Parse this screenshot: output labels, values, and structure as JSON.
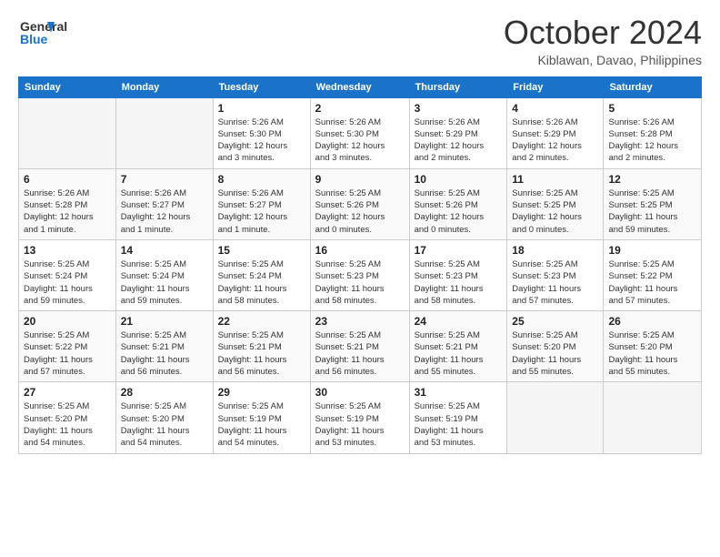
{
  "logo": {
    "line1": "General",
    "line2": "Blue"
  },
  "title": "October 2024",
  "subtitle": "Kiblawan, Davao, Philippines",
  "weekdays": [
    "Sunday",
    "Monday",
    "Tuesday",
    "Wednesday",
    "Thursday",
    "Friday",
    "Saturday"
  ],
  "weeks": [
    [
      {
        "day": "",
        "info": ""
      },
      {
        "day": "",
        "info": ""
      },
      {
        "day": "1",
        "info": "Sunrise: 5:26 AM\nSunset: 5:30 PM\nDaylight: 12 hours\nand 3 minutes."
      },
      {
        "day": "2",
        "info": "Sunrise: 5:26 AM\nSunset: 5:30 PM\nDaylight: 12 hours\nand 3 minutes."
      },
      {
        "day": "3",
        "info": "Sunrise: 5:26 AM\nSunset: 5:29 PM\nDaylight: 12 hours\nand 2 minutes."
      },
      {
        "day": "4",
        "info": "Sunrise: 5:26 AM\nSunset: 5:29 PM\nDaylight: 12 hours\nand 2 minutes."
      },
      {
        "day": "5",
        "info": "Sunrise: 5:26 AM\nSunset: 5:28 PM\nDaylight: 12 hours\nand 2 minutes."
      }
    ],
    [
      {
        "day": "6",
        "info": "Sunrise: 5:26 AM\nSunset: 5:28 PM\nDaylight: 12 hours\nand 1 minute."
      },
      {
        "day": "7",
        "info": "Sunrise: 5:26 AM\nSunset: 5:27 PM\nDaylight: 12 hours\nand 1 minute."
      },
      {
        "day": "8",
        "info": "Sunrise: 5:26 AM\nSunset: 5:27 PM\nDaylight: 12 hours\nand 1 minute."
      },
      {
        "day": "9",
        "info": "Sunrise: 5:25 AM\nSunset: 5:26 PM\nDaylight: 12 hours\nand 0 minutes."
      },
      {
        "day": "10",
        "info": "Sunrise: 5:25 AM\nSunset: 5:26 PM\nDaylight: 12 hours\nand 0 minutes."
      },
      {
        "day": "11",
        "info": "Sunrise: 5:25 AM\nSunset: 5:25 PM\nDaylight: 12 hours\nand 0 minutes."
      },
      {
        "day": "12",
        "info": "Sunrise: 5:25 AM\nSunset: 5:25 PM\nDaylight: 11 hours\nand 59 minutes."
      }
    ],
    [
      {
        "day": "13",
        "info": "Sunrise: 5:25 AM\nSunset: 5:24 PM\nDaylight: 11 hours\nand 59 minutes."
      },
      {
        "day": "14",
        "info": "Sunrise: 5:25 AM\nSunset: 5:24 PM\nDaylight: 11 hours\nand 59 minutes."
      },
      {
        "day": "15",
        "info": "Sunrise: 5:25 AM\nSunset: 5:24 PM\nDaylight: 11 hours\nand 58 minutes."
      },
      {
        "day": "16",
        "info": "Sunrise: 5:25 AM\nSunset: 5:23 PM\nDaylight: 11 hours\nand 58 minutes."
      },
      {
        "day": "17",
        "info": "Sunrise: 5:25 AM\nSunset: 5:23 PM\nDaylight: 11 hours\nand 58 minutes."
      },
      {
        "day": "18",
        "info": "Sunrise: 5:25 AM\nSunset: 5:23 PM\nDaylight: 11 hours\nand 57 minutes."
      },
      {
        "day": "19",
        "info": "Sunrise: 5:25 AM\nSunset: 5:22 PM\nDaylight: 11 hours\nand 57 minutes."
      }
    ],
    [
      {
        "day": "20",
        "info": "Sunrise: 5:25 AM\nSunset: 5:22 PM\nDaylight: 11 hours\nand 57 minutes."
      },
      {
        "day": "21",
        "info": "Sunrise: 5:25 AM\nSunset: 5:21 PM\nDaylight: 11 hours\nand 56 minutes."
      },
      {
        "day": "22",
        "info": "Sunrise: 5:25 AM\nSunset: 5:21 PM\nDaylight: 11 hours\nand 56 minutes."
      },
      {
        "day": "23",
        "info": "Sunrise: 5:25 AM\nSunset: 5:21 PM\nDaylight: 11 hours\nand 56 minutes."
      },
      {
        "day": "24",
        "info": "Sunrise: 5:25 AM\nSunset: 5:21 PM\nDaylight: 11 hours\nand 55 minutes."
      },
      {
        "day": "25",
        "info": "Sunrise: 5:25 AM\nSunset: 5:20 PM\nDaylight: 11 hours\nand 55 minutes."
      },
      {
        "day": "26",
        "info": "Sunrise: 5:25 AM\nSunset: 5:20 PM\nDaylight: 11 hours\nand 55 minutes."
      }
    ],
    [
      {
        "day": "27",
        "info": "Sunrise: 5:25 AM\nSunset: 5:20 PM\nDaylight: 11 hours\nand 54 minutes."
      },
      {
        "day": "28",
        "info": "Sunrise: 5:25 AM\nSunset: 5:20 PM\nDaylight: 11 hours\nand 54 minutes."
      },
      {
        "day": "29",
        "info": "Sunrise: 5:25 AM\nSunset: 5:19 PM\nDaylight: 11 hours\nand 54 minutes."
      },
      {
        "day": "30",
        "info": "Sunrise: 5:25 AM\nSunset: 5:19 PM\nDaylight: 11 hours\nand 53 minutes."
      },
      {
        "day": "31",
        "info": "Sunrise: 5:25 AM\nSunset: 5:19 PM\nDaylight: 11 hours\nand 53 minutes."
      },
      {
        "day": "",
        "info": ""
      },
      {
        "day": "",
        "info": ""
      }
    ]
  ]
}
